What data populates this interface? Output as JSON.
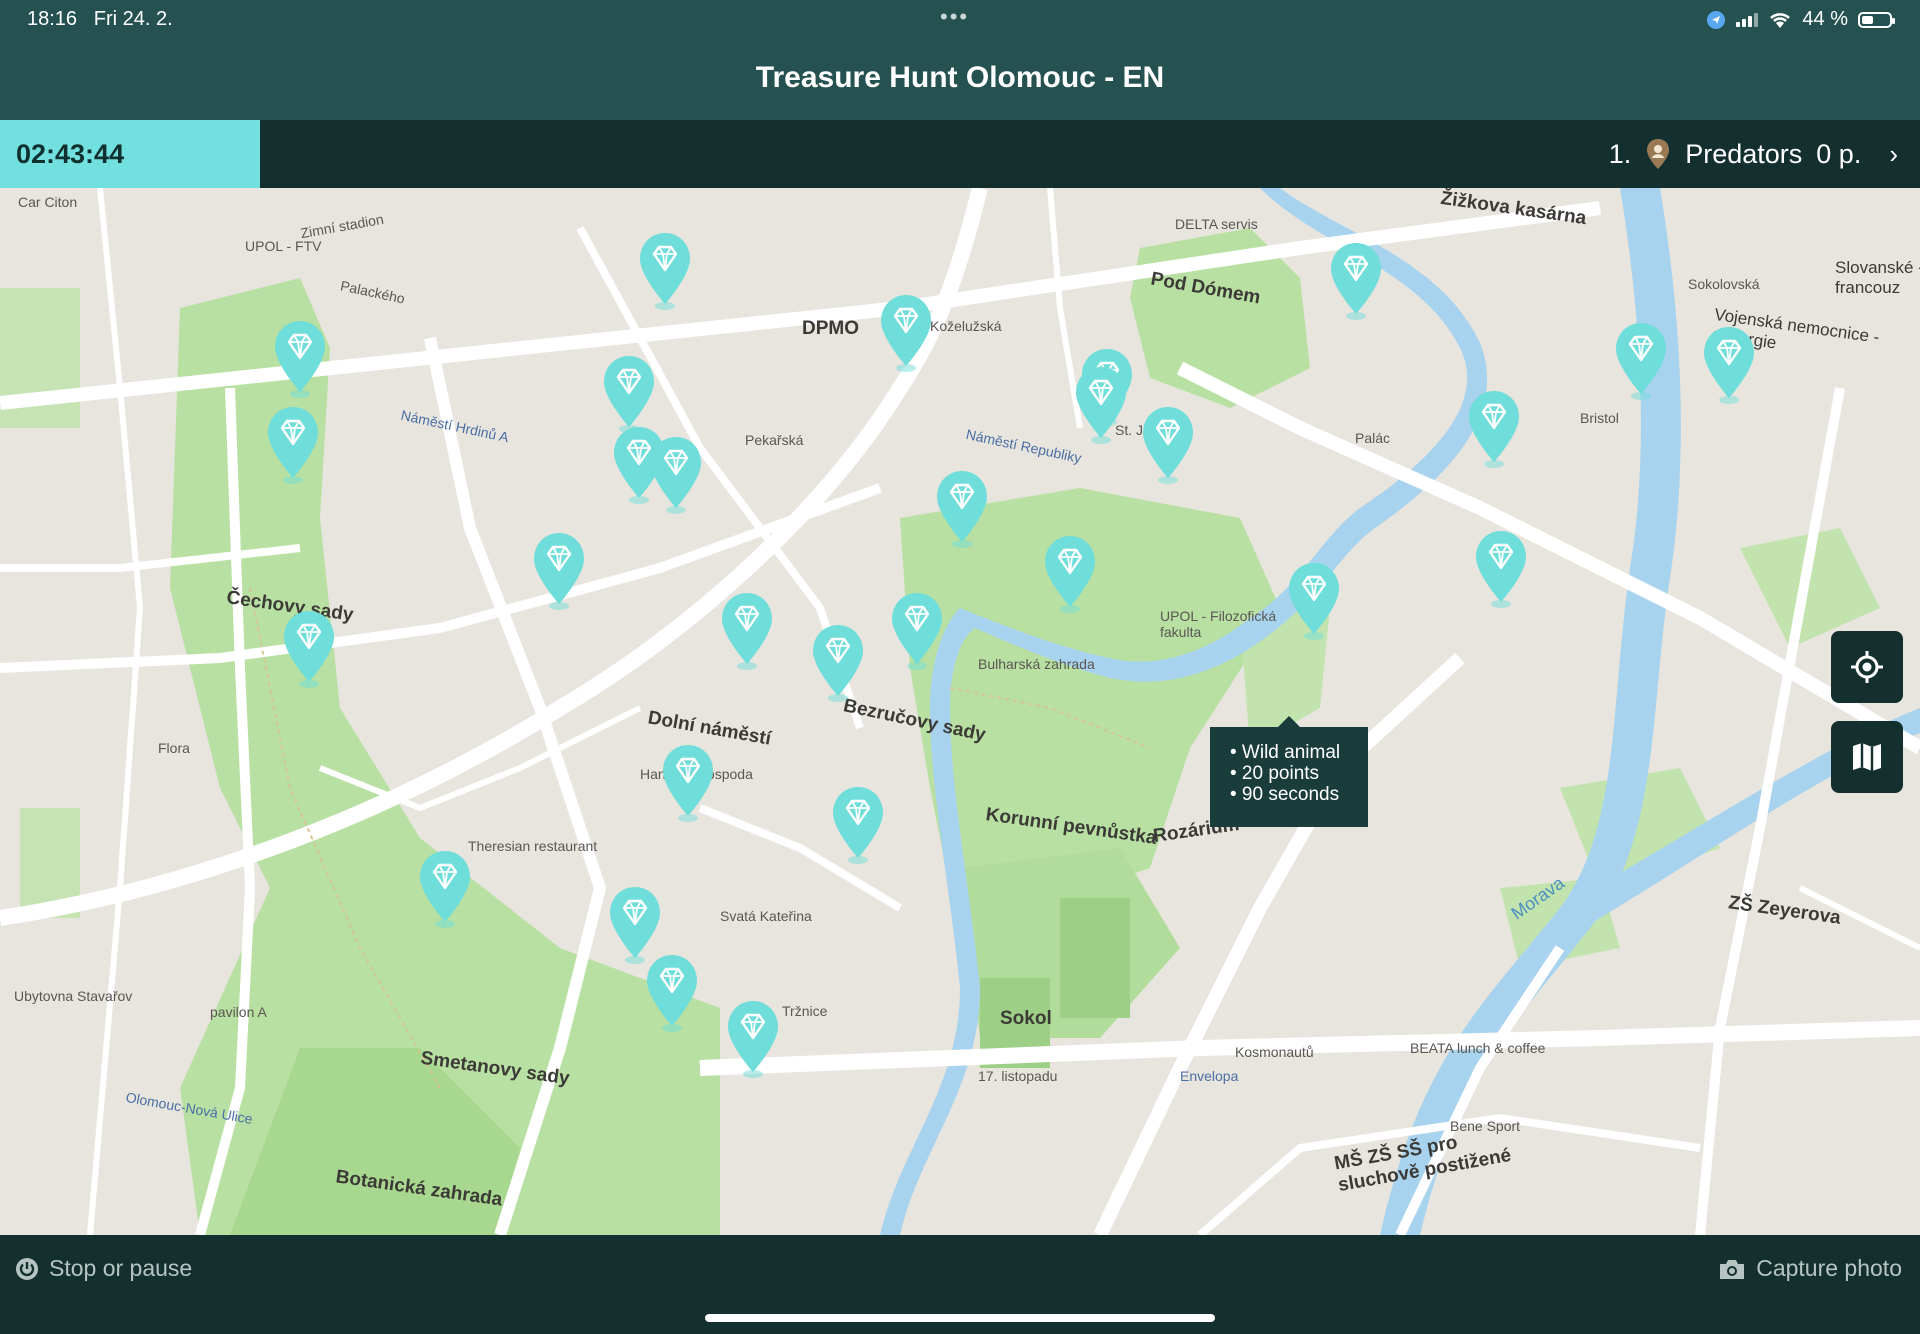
{
  "status_bar": {
    "time": "18:16",
    "date": "Fri 24. 2.",
    "battery": "44 %",
    "battery_level": 0.44
  },
  "header": {
    "title": "Treasure Hunt Olomouc - EN"
  },
  "info_bar": {
    "timer": "02:43:44",
    "team_rank": "1.",
    "team_name": "Predators",
    "team_points": "0 p."
  },
  "map": {
    "pin_icon": "diamond-icon",
    "accent_color": "#6fddd9",
    "tooltip": {
      "lines": [
        "• Wild animal",
        "• 20 points",
        "• 90 seconds"
      ]
    },
    "labels": {
      "cechovy_sady": "Čechovy sady",
      "smetanovy_sady": "Smetanovy sady",
      "botanicka": "Botanická zahrada",
      "korunni": "Korunní pevnůstka",
      "rozarium": "Rozárium",
      "bezrucovy": "Bezručovy sady",
      "dolni": "Dolní náměstí",
      "pod_domem": "Pod Dómem",
      "sokol": "Sokol",
      "zizkova": "Žižkova kasárna",
      "zs_zeyerova": "ZŠ Zeyerova",
      "ms_zs": "MŠ ZŠ SŠ pro sluchově postižené",
      "morava": "Morava",
      "kosmonautu": "Kosmonautů",
      "listopadu": "17. listopadu",
      "nemocnice": "Vojenská nemocnice - chirurgie",
      "namesti_republiky": "Náměstí Republiky",
      "namesti_hrdinu": "Náměstí Hrdinů A",
      "dpmo": "DPMO",
      "upol_ftv": "UPOL - FTV",
      "zimni_stadion": "Zimní stadion",
      "car_citon": "Car Citon",
      "pekarska": "Pekařská",
      "st_joseph": "St. Joseph",
      "kozeluzska": "Koželužská",
      "delta": "DELTA servis",
      "flora": "Flora",
      "pavilon_a": "pavilon A",
      "svatek": "Svatá Kateřina",
      "hanacka": "Hanácká hospoda",
      "theresian": "Theresian restaurant",
      "tram": "Tržnice",
      "slovanske": "Slovanské - francouz",
      "sokolovska": "Sokolovská",
      "palackeho": "Palackého",
      "bristol": "Bristol",
      "hospital": "UPOL - Filozofická fakulta",
      "zahrada": "Bulharská zahrada",
      "envelopa": "Envelopa",
      "ubytovna": "Ubytovna Stavařov",
      "olomouc_nova": "Olomouc-Nová Ulice",
      "beata": "BEATA lunch & coffee",
      "bene": "Bene Sport",
      "palac": "Palác"
    }
  },
  "bottom_bar": {
    "stop_label": "Stop or pause",
    "capture_label": "Capture photo"
  }
}
